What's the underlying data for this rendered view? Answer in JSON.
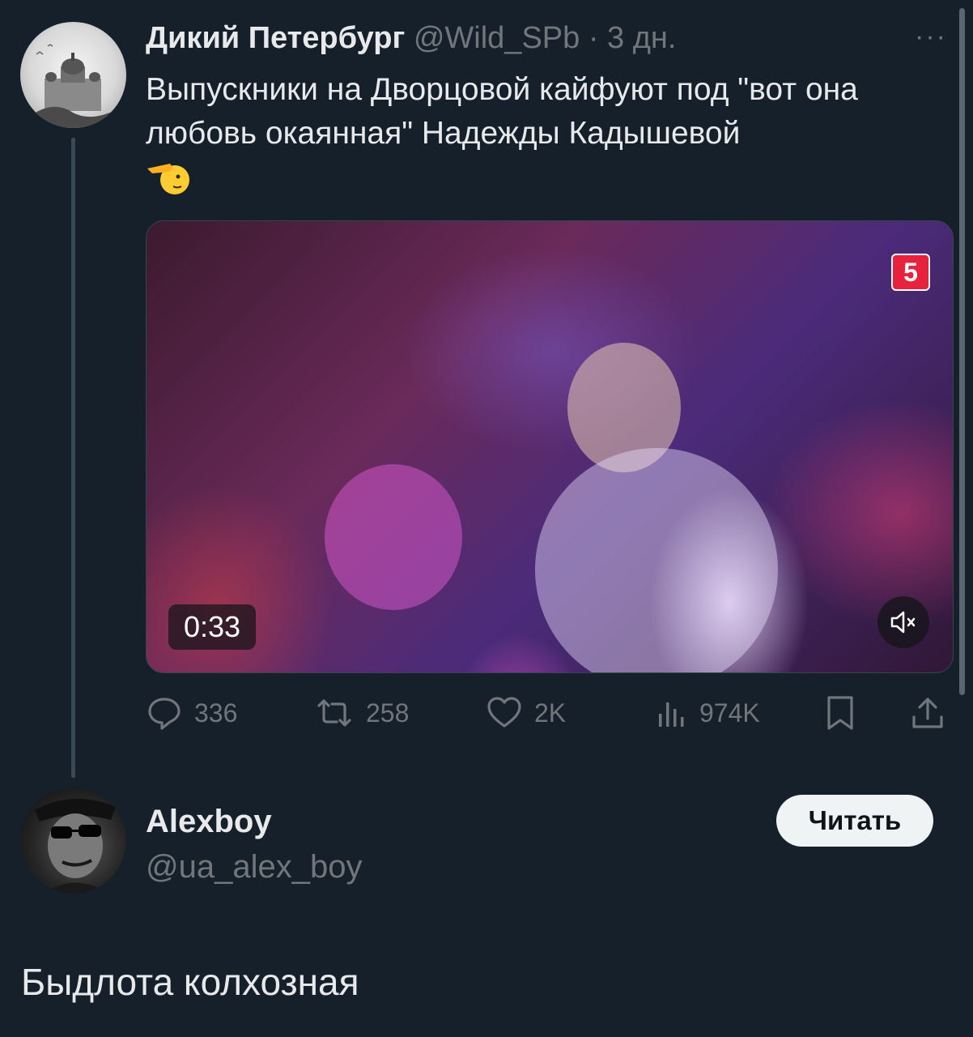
{
  "original_tweet": {
    "author_name": "Дикий Петербург",
    "meta": "@Wild_SPb · 3 дн.",
    "more_label": "···",
    "text": "Выпускники на Дворцовой кайфуют под \"вот она любовь окаянная\" Надежды Кадышевой",
    "emoji": "saluting-face",
    "media": {
      "channel_badge": "5",
      "duration": "0:33",
      "muted": true
    },
    "actions": {
      "replies": "336",
      "retweets": "258",
      "likes": "2K",
      "views": "974K"
    }
  },
  "reply": {
    "author_name": "Alexboy",
    "handle": "@ua_alex_boy",
    "follow_label": "Читать",
    "text": "Быдлота колхозная"
  },
  "colors": {
    "background": "#15202b",
    "primary_text": "#e7e9ea",
    "secondary_text": "#71767b",
    "follow_button_bg": "#eff3f4"
  }
}
